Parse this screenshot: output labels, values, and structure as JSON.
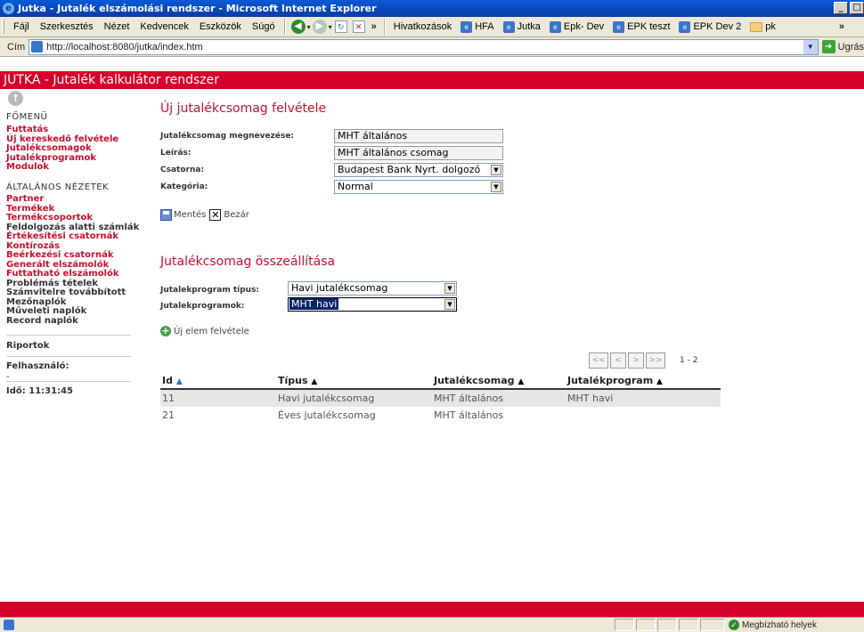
{
  "window": {
    "title": "Jutka - Jutalék elszámolási rendszer - Microsoft Internet Explorer",
    "controls": [
      "_",
      "□"
    ]
  },
  "menubar": {
    "items": [
      "Fájl",
      "Szerkesztés",
      "Nézet",
      "Kedvencek",
      "Eszközök",
      "Súgó"
    ],
    "chevron": "»",
    "links_label": "Hivatkozások",
    "links": [
      "HFA",
      "Jutka",
      "Epk- Dev",
      "EPK teszt",
      "EPK Dev 2",
      "pk"
    ],
    "more": "»"
  },
  "addressbar": {
    "label": "Cím",
    "url": "http://localhost:8080/jutka/index.htm",
    "go_label": "Ugrás"
  },
  "app": {
    "title": "JUTKA - Jutalék kalkulátor rendszer",
    "accent_color": "#d4002a"
  },
  "sidebar": {
    "up_icon": "↑",
    "main_menu_title": "FŐMENÜ",
    "main_items": [
      "Futtatás",
      "Új kereskedő felvétele",
      "Jutalékcsomagok",
      "Jutalékprogramok",
      "Modulok"
    ],
    "general_title": "ÁLTALÁNOS NÉZETEK",
    "general_items": [
      {
        "label": "Partner",
        "style": "red"
      },
      {
        "label": "Termékek",
        "style": "red"
      },
      {
        "label": "Termékcsoportok",
        "style": "red"
      },
      {
        "label": "Feldolgozás alatti számlák",
        "style": "dark"
      },
      {
        "label": "Értékesítési csatornák",
        "style": "red"
      },
      {
        "label": "Kontírozás",
        "style": "red"
      },
      {
        "label": "Beérkezési csatornák",
        "style": "red"
      },
      {
        "label": "Generált elszámolók",
        "style": "red"
      },
      {
        "label": "Futtatható elszámolók",
        "style": "red"
      },
      {
        "label": "Problémás tételek",
        "style": "dark"
      },
      {
        "label": "Számvitelre továbbított",
        "style": "dark"
      },
      {
        "label": "Mezőnaplók",
        "style": "dark"
      },
      {
        "label": "Műveleti naplók",
        "style": "dark"
      },
      {
        "label": "Record naplók",
        "style": "dark"
      }
    ],
    "reports": "Riportok",
    "user_label": "Felhasználó:",
    "user_value": "-",
    "time_label": "Idő: 11:31:45"
  },
  "form": {
    "title": "Új jutalékcsomag felvétele",
    "fields": {
      "name_label": "Jutalékcsomag megnevezése:",
      "name_value": "MHT általános",
      "desc_label": "Leírás:",
      "desc_value": "MHT általános csomag",
      "channel_label": "Csatorna:",
      "channel_value": "Budapest Bank Nyrt. dolgozó",
      "category_label": "Kategória:",
      "category_value": "Normal"
    },
    "save_label": "Mentés",
    "close_label": "Bezár"
  },
  "assembly": {
    "title": "Jutalékcsomag összeállítása",
    "type_label": "Jutalekprogram típus:",
    "type_value": "Havi jutalékcsomag",
    "programs_label": "Jutalekprogramok:",
    "programs_value": "MHT havi",
    "add_label": "Új elem felvétele"
  },
  "pager": {
    "first": "<<",
    "prev": "<",
    "next": ">",
    "last": ">>",
    "range": "1 - 2"
  },
  "table": {
    "headers": [
      "Id",
      "Típus",
      "Jutalékcsomag",
      "Jutalékprogram"
    ],
    "rows": [
      [
        "11",
        "Havi jutalékcsomag",
        "MHT általános",
        "MHT havi"
      ],
      [
        "21",
        "Éves jutalékcsomag",
        "MHT általános",
        ""
      ]
    ]
  },
  "statusbar": {
    "zone": "Megbízható helyek"
  }
}
